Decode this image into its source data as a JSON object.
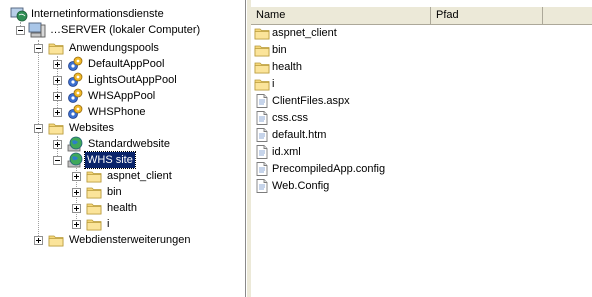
{
  "tree": {
    "root": {
      "label": "Internetinformationsdienste",
      "icon": "iis-services-icon"
    },
    "server": {
      "label": "…SERVER (lokaler Computer)",
      "icon": "computer-icon"
    },
    "app_pools": {
      "label": "Anwendungspools",
      "items": [
        {
          "label": "DefaultAppPool"
        },
        {
          "label": "LightsOutAppPool"
        },
        {
          "label": "WHSAppPool"
        },
        {
          "label": "WHSPhone"
        }
      ]
    },
    "websites": {
      "label": "Websites",
      "items": [
        {
          "label": "Standardwebsite"
        },
        {
          "label": "WHS site",
          "selected": true
        }
      ],
      "whs_children": [
        {
          "label": "aspnet_client"
        },
        {
          "label": "bin"
        },
        {
          "label": "health"
        },
        {
          "label": "i"
        }
      ]
    },
    "web_extensions": {
      "label": "Webdiensterweiterungen"
    }
  },
  "list": {
    "columns": [
      "Name",
      "Pfad"
    ],
    "items": [
      {
        "label": "aspnet_client",
        "icon": "folder-icon"
      },
      {
        "label": "bin",
        "icon": "folder-icon"
      },
      {
        "label": "health",
        "icon": "folder-icon"
      },
      {
        "label": "i",
        "icon": "folder-icon"
      },
      {
        "label": "ClientFiles.aspx",
        "icon": "file-icon"
      },
      {
        "label": "css.css",
        "icon": "file-icon"
      },
      {
        "label": "default.htm",
        "icon": "file-icon"
      },
      {
        "label": "id.xml",
        "icon": "file-icon"
      },
      {
        "label": "PrecompiledApp.config",
        "icon": "file-icon"
      },
      {
        "label": "Web.Config",
        "icon": "file-icon"
      }
    ]
  },
  "colors": {
    "selection": "#0a246a",
    "folder": "#f5d77a",
    "header": "#ece9d8"
  }
}
